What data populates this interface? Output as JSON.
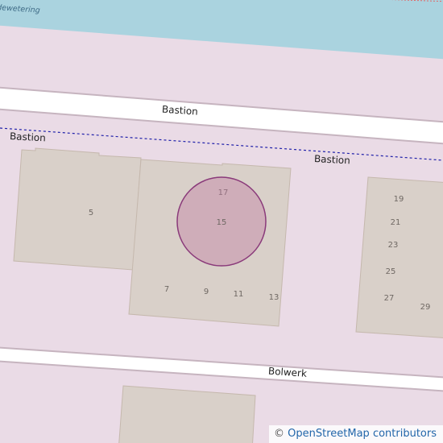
{
  "map": {
    "background_color": "#eadbe6",
    "water": {
      "color": "#aad3df",
      "label": "dewetering"
    },
    "roads": [
      {
        "name": "Bastion",
        "kind": "street"
      },
      {
        "name": "Bolwerk",
        "kind": "street"
      }
    ],
    "boundary_labels": [
      "Bastion",
      "Bastion"
    ],
    "buildings": {
      "fill": "#d9d0c9",
      "stroke": "#c5b8ad"
    },
    "house_numbers": [
      "5",
      "17",
      "15",
      "7",
      "9",
      "11",
      "13",
      "19",
      "21",
      "23",
      "25",
      "27",
      "29"
    ],
    "marker": {
      "fill": "#c17ba5",
      "stroke": "#8a3a7a",
      "address_number": "15"
    }
  },
  "attribution": {
    "copyright_symbol": "©",
    "text": "OpenStreetMap contributors"
  }
}
